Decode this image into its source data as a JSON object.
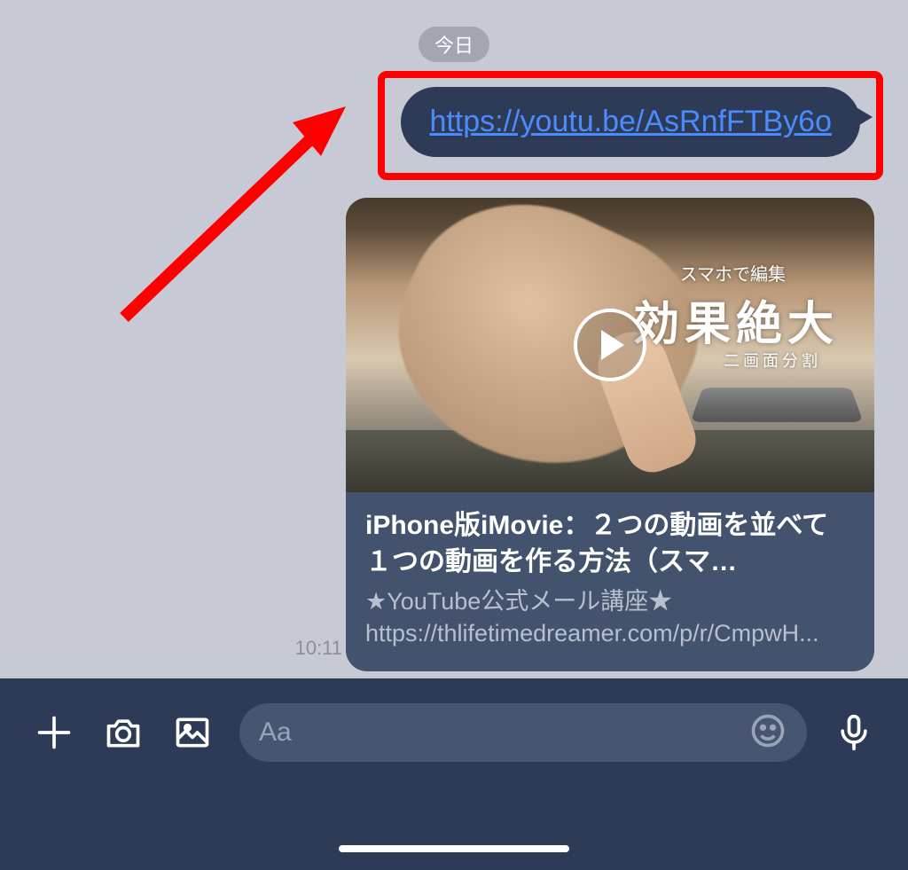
{
  "date_label": "今日",
  "message": {
    "url": "https://youtu.be/AsRnfFTBy6o",
    "timestamp": "10:11"
  },
  "preview": {
    "thumb_overline": "スマホで編集",
    "thumb_title": "効果絶大",
    "thumb_sub": "二画面分割",
    "title": "iPhone版iMovie：２つの動画を並べて１つの動画を作る方法（スマ…",
    "description": "★YouTube公式メール講座★ https://thlifetimedreamer.com/p/r/CmpwH..."
  },
  "input": {
    "placeholder": "Aa"
  },
  "annotation": {
    "highlight_color": "#ff0000"
  }
}
